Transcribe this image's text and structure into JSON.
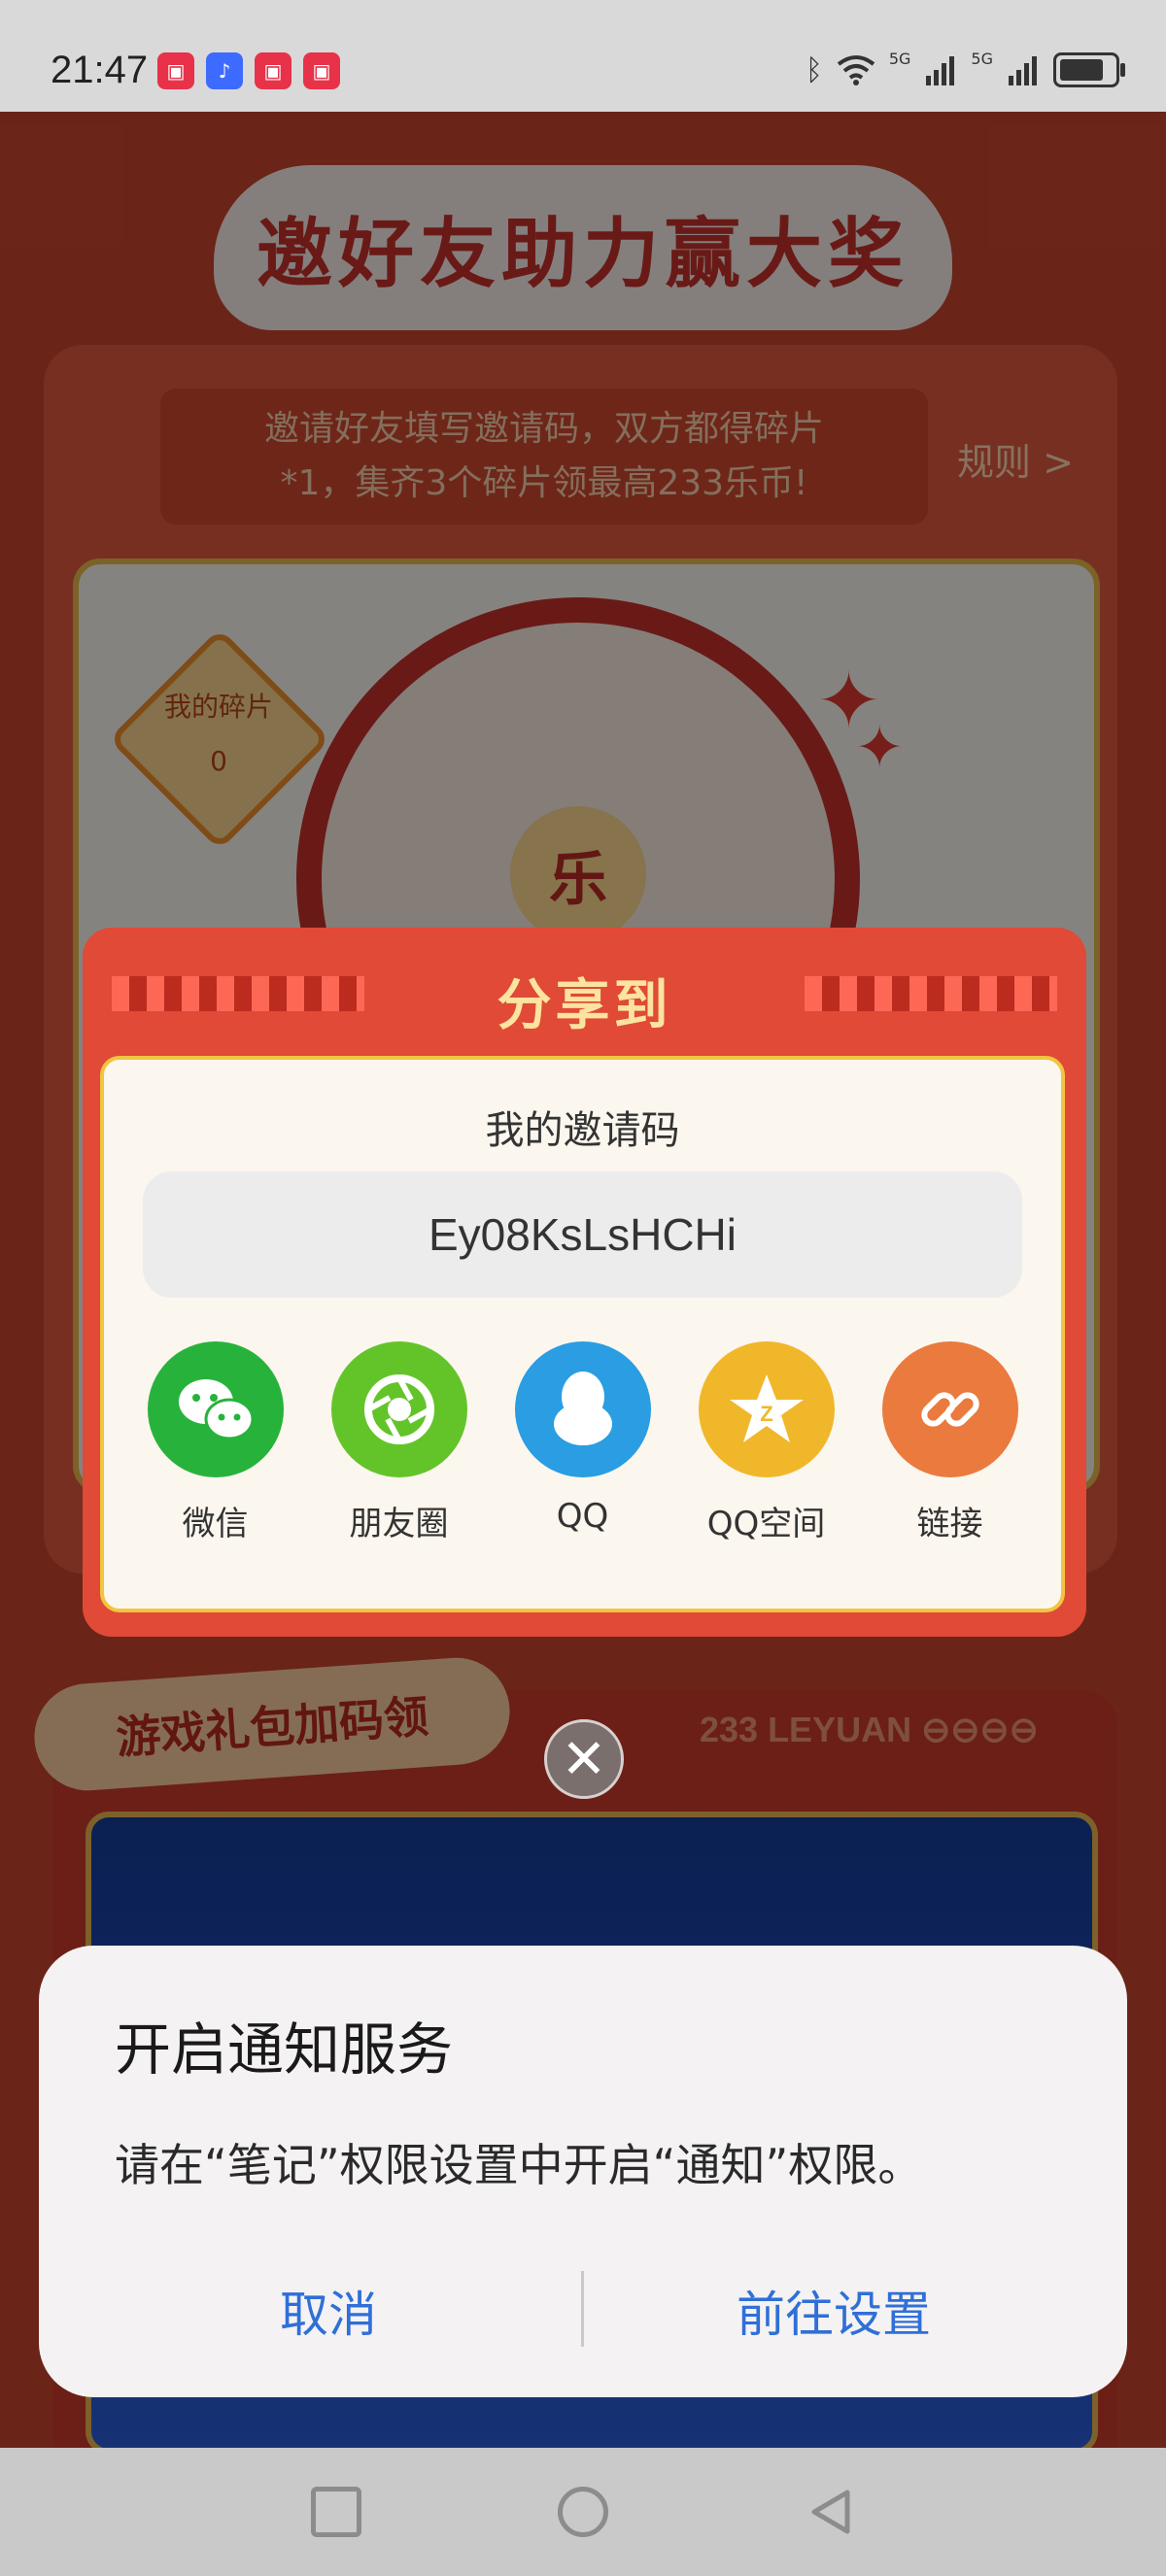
{
  "status_bar": {
    "time": "21:47",
    "app_badges": [
      "app-badge-1",
      "music-app",
      "app-badge-3",
      "app-badge-4"
    ],
    "icons": [
      "bluetooth-icon",
      "wifi-icon",
      "signal-5g-icon",
      "signal-5g-icon",
      "battery-icon"
    ],
    "network_label_1": "5G",
    "network_label_2": "5G"
  },
  "page": {
    "title": "邀好友助力赢大奖",
    "invite_banner_line1": "邀请好友填写邀请码，双方都得碎片",
    "invite_banner_line2": "*1，集齐3个碎片领最高233乐币!",
    "rules_link": "规则 >",
    "fragment_label": "我的碎片",
    "fragment_count": "0",
    "wheel_center": "乐",
    "gift_section_title": "游戏礼包加码领",
    "leyuan_text": "233 LEYUAN"
  },
  "share_modal": {
    "title": "分享到",
    "invite_code_label": "我的邀请码",
    "invite_code": "Ey08KsLsHCHi",
    "options": [
      {
        "label": "微信",
        "icon": "wechat-icon",
        "color": "#27b33b"
      },
      {
        "label": "朋友圈",
        "icon": "moments-icon",
        "color": "#63c42a"
      },
      {
        "label": "QQ",
        "icon": "qq-icon",
        "color": "#2a9de3"
      },
      {
        "label": "QQ空间",
        "icon": "qzone-icon",
        "color": "#f0b72a"
      },
      {
        "label": "链接",
        "icon": "link-icon",
        "color": "#ea7a3d"
      }
    ],
    "close_icon": "close-icon"
  },
  "dialog": {
    "title": "开启通知服务",
    "message": "请在“笔记”权限设置中开启“通知”权限。",
    "cancel_label": "取消",
    "settings_label": "前往设置",
    "accent_color": "#2f6fd8"
  },
  "nav_bar": {
    "icons": [
      "recent-apps-icon",
      "home-icon",
      "back-icon"
    ]
  }
}
